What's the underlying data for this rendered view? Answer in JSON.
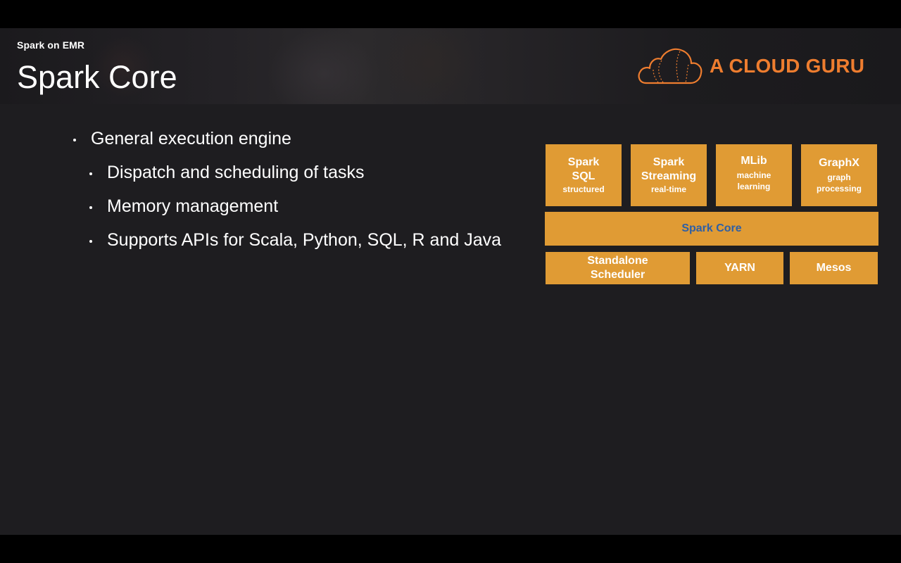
{
  "header": {
    "subtitle": "Spark on EMR",
    "title": "Spark Core",
    "logo_text": "A CLOUD GURU",
    "logo_icon": "cloud-icon",
    "logo_color": "#ee7d2f"
  },
  "bullets": [
    {
      "text": "General execution engine",
      "level": 1
    },
    {
      "text": "Dispatch and scheduling of tasks",
      "level": 2
    },
    {
      "text": "Memory management",
      "level": 2
    },
    {
      "text": "Supports APIs for Scala, Python, SQL, R and Java",
      "level": 2
    }
  ],
  "diagram": {
    "box_color": "#e09b34",
    "core_text_color": "#2d5fa6",
    "libraries": [
      {
        "title": "Spark SQL",
        "title_lines": [
          "Spark",
          "SQL"
        ],
        "sub": "structured"
      },
      {
        "title": "Spark Streaming",
        "title_lines": [
          "Spark",
          "Streaming"
        ],
        "sub": "real-time"
      },
      {
        "title": "MLib",
        "title_lines": [
          "MLib"
        ],
        "sub": "machine learning",
        "sub_lines": [
          "machine",
          "learning"
        ]
      },
      {
        "title": "GraphX",
        "title_lines": [
          "GraphX"
        ],
        "sub": "graph processing",
        "sub_lines": [
          "graph",
          "processing"
        ]
      }
    ],
    "core": "Spark Core",
    "schedulers": [
      {
        "label": "Standalone Scheduler",
        "lines": [
          "Standalone",
          "Scheduler"
        ]
      },
      {
        "label": "YARN",
        "lines": [
          "YARN"
        ]
      },
      {
        "label": "Mesos",
        "lines": [
          "Mesos"
        ]
      }
    ]
  }
}
